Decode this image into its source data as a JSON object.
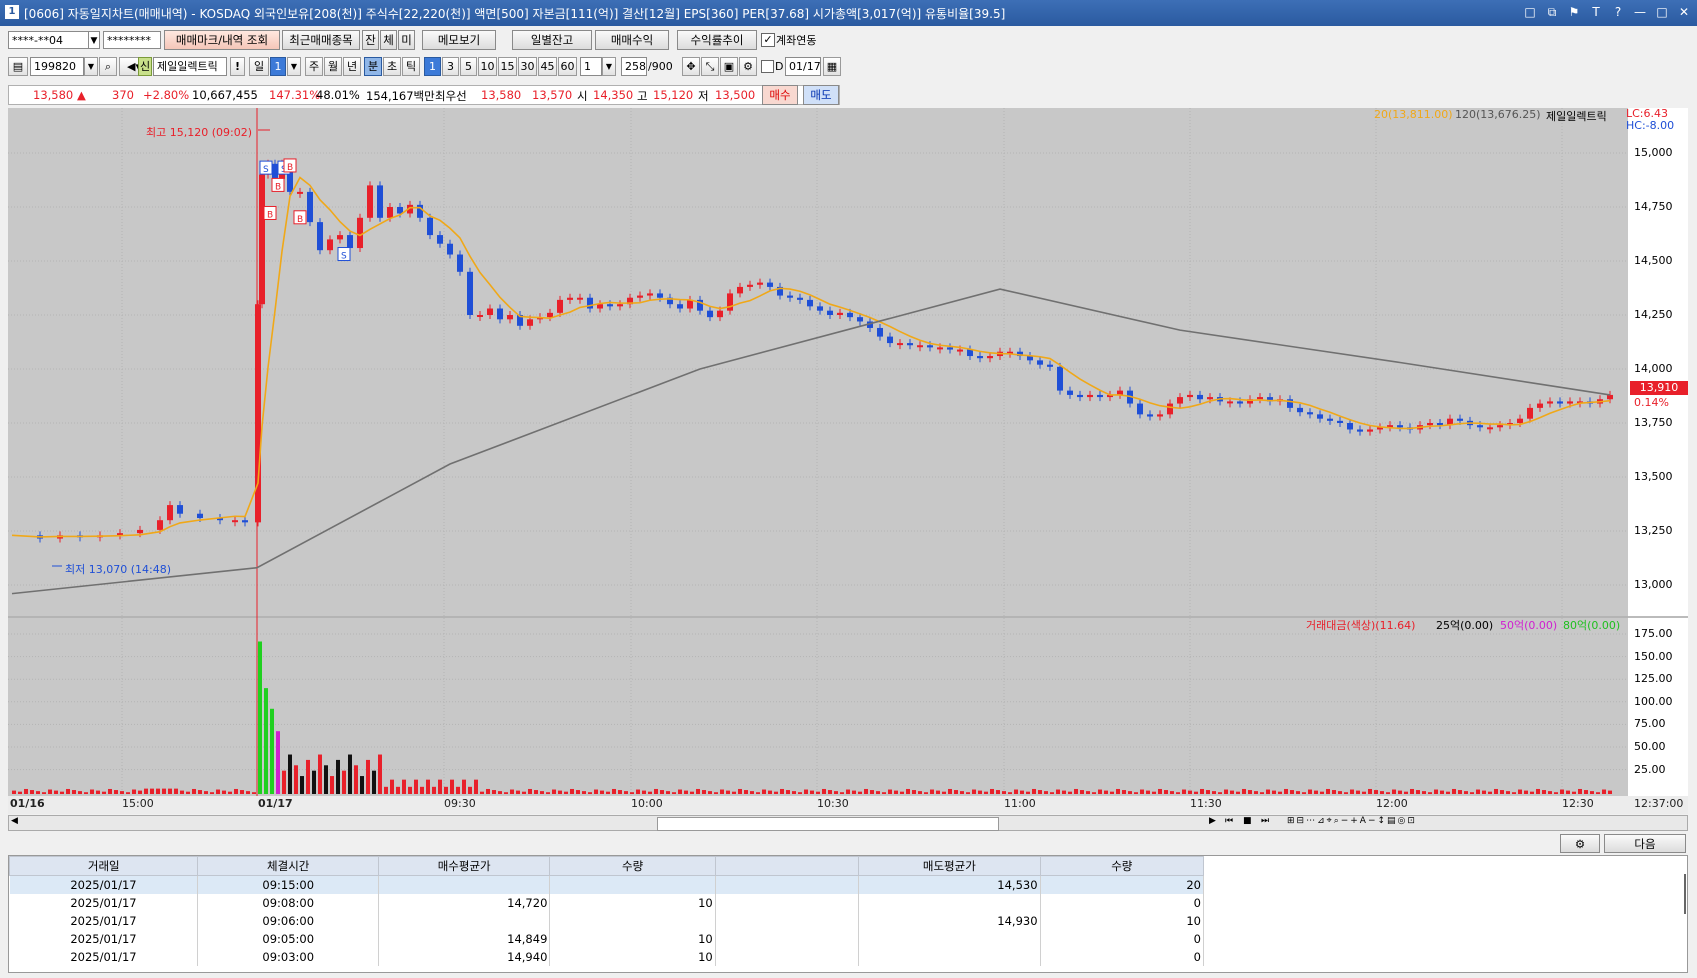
{
  "window": {
    "title": "[0606] 자동일지차트(매매내역) - KOSDAQ 외국인보유[208(천)] 주식수[22,220(천)] 액면[500] 자본금[111(억)] 결산[12월] EPS[360] PER[37.68] 시가총액[3,017(억)] 유통비율[39.5]",
    "app_icon": "1",
    "buttons": [
      "□",
      "⧉",
      "⚑",
      "T",
      "?",
      "—",
      "□",
      "✕"
    ]
  },
  "toolbar1": {
    "account": "****-**04",
    "password": "********",
    "btn_trade_mark": "매매마크/내역 조회",
    "btn_recent": "최근매매종목",
    "tab_jan": "잔",
    "tab_che": "체",
    "tab_mi": "미",
    "btn_memo": "메모보기",
    "btn_daily_balance": "일별잔고",
    "btn_trade_profit": "매매수익",
    "btn_profit_trend": "수익률추이",
    "chk_link": "계좌연동"
  },
  "toolbar2": {
    "code": "199820",
    "name_badge": "신",
    "name": "제일일렉트릭",
    "excl": "!",
    "period_label": "일",
    "period_val": "1",
    "tab_week": "주",
    "tab_month": "월",
    "tab_year": "년",
    "tab_min": "분",
    "tab_sec": "초",
    "tab_tick": "틱",
    "intervals": [
      "1",
      "3",
      "5",
      "10",
      "15",
      "30",
      "45",
      "60"
    ],
    "interval_sel": "1",
    "count": "258",
    "count_max": "/900",
    "d_label": "D",
    "date": "01/17"
  },
  "quote": {
    "price": "13,580",
    "arrow": "▲",
    "change": "370",
    "change_pct": "+2.80%",
    "volume": "10,667,455",
    "vol_ratio": "147.31%",
    "turnover": "48.01%",
    "amount": "154,167백만",
    "label_best": "최우선",
    "ask": "13,580",
    "bid": "13,570",
    "label_open": "시",
    "open": "14,350",
    "label_high": "고",
    "high": "15,120",
    "label_low": "저",
    "low": "13,500",
    "btn_buy": "매수",
    "btn_sell": "매도"
  },
  "chart": {
    "legend_ma20": "20(13,811.00)",
    "legend_ma120": "120(13,676.25)",
    "legend_name": "제일일렉트릭",
    "lc": "LC:6.43",
    "hc": "HC:-8.00",
    "price_ticks": [
      "15,000",
      "14,750",
      "14,500",
      "14,250",
      "14,000",
      "13,750",
      "13,500",
      "13,250",
      "13,000"
    ],
    "current_price": "13,910",
    "current_pct": "0.14%",
    "high_note": "최고 15,120 (09:02)",
    "low_note": "최저 13,070 (14:48)",
    "vol_legend_1": "거래대금(색상)(11.64)",
    "vol_legend_2": "25억(0.00)",
    "vol_legend_3": "50억(0.00)",
    "vol_legend_4": "80억(0.00)",
    "vol_ticks": [
      "175.00",
      "150.00",
      "125.00",
      "100.00",
      "75.00",
      "50.00",
      "25.00"
    ],
    "time_labels": [
      "01/16",
      "15:00",
      "01/17",
      "09:30",
      "10:00",
      "10:30",
      "11:00",
      "11:30",
      "12:00",
      "12:30",
      "12:37:00"
    ],
    "colors": {
      "up": "#e8202a",
      "down": "#1f4fd6",
      "ma20": "#f0a818",
      "ma120": "#707070",
      "bg": "#c8c8c8"
    }
  },
  "bottom": {
    "btn_next": "다음"
  },
  "table": {
    "headers": [
      "거래일",
      "체결시간",
      "매수평균가",
      "수량",
      "",
      "매도평균가",
      "수량"
    ],
    "rows": [
      [
        "2025/01/17",
        "09:15:00",
        "",
        "",
        "",
        "14,530",
        "20"
      ],
      [
        "2025/01/17",
        "09:08:00",
        "14,720",
        "10",
        "",
        "",
        "0"
      ],
      [
        "2025/01/17",
        "09:06:00",
        "",
        "",
        "",
        "14,930",
        "10"
      ],
      [
        "2025/01/17",
        "09:05:00",
        "14,849",
        "10",
        "",
        "",
        "0"
      ],
      [
        "2025/01/17",
        "09:03:00",
        "14,940",
        "10",
        "",
        "",
        "0"
      ]
    ]
  }
}
